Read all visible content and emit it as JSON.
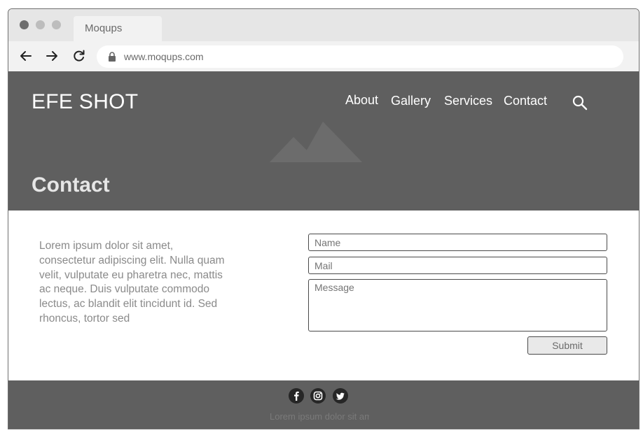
{
  "browser": {
    "tab_title": "Moqups",
    "url": "www.moqups.com",
    "traffic_light_colors": [
      "#6e6e6e",
      "#bdbdbd",
      "#bdbdbd"
    ]
  },
  "site": {
    "brand": "EFE SHOT",
    "nav": [
      "About",
      "Gallery",
      "Services",
      "Contact"
    ],
    "page_title": "Contact",
    "hero_color": "#5f5f5f"
  },
  "content": {
    "paragraph": "Lorem ipsum dolor sit amet, consectetur adipiscing elit. Nulla quam velit, vulputate eu pharetra nec, mattis ac neque. Duis vulputate commodo lectus, ac blandit elit tincidunt id. Sed rhoncus, tortor sed"
  },
  "form": {
    "name_placeholder": "Name",
    "mail_placeholder": "Mail",
    "message_placeholder": "Message",
    "submit_label": "Submit"
  },
  "footer": {
    "social_icons": [
      "facebook-icon",
      "instagram-icon",
      "twitter-icon"
    ],
    "text": "Lorem ipsum dolor sit amet"
  }
}
